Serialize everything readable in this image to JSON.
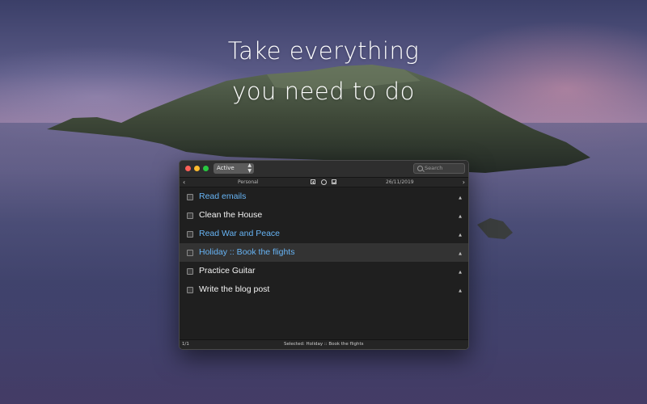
{
  "headline": {
    "line1": "Take everything",
    "line2": "you need to do"
  },
  "window": {
    "filter": {
      "value": "Active",
      "icon": "updown-arrows-icon"
    },
    "search": {
      "placeholder": "Search",
      "icon": "search-icon"
    },
    "nav": {
      "prev_icon": "chevron-left-icon",
      "next_icon": "chevron-right-icon",
      "list_name": "Personal",
      "date": "26/11/2019",
      "tools": [
        "add-icon",
        "circle-icon",
        "checkbox-icon"
      ]
    },
    "tasks": [
      {
        "title": "Read emails",
        "color": "#67b4f5",
        "selected": false
      },
      {
        "title": "Clean the House",
        "color": "#f2f2f2",
        "selected": false
      },
      {
        "title": "Read War and Peace",
        "color": "#67b4f5",
        "selected": false
      },
      {
        "title": "Holiday :: Book the flights",
        "color": "#67b4f5",
        "selected": true
      },
      {
        "title": "Practice Guitar",
        "color": "#f2f2f2",
        "selected": false
      },
      {
        "title": "Write the blog post",
        "color": "#f2f2f2",
        "selected": false
      }
    ],
    "status": {
      "count": "1/1",
      "selected": "Selected: Holiday :: Book the flights"
    }
  },
  "colors": {
    "accent_blue": "#67b4f5",
    "traffic_red": "#fe5f57",
    "traffic_yellow": "#febb2e",
    "traffic_green": "#28c840"
  }
}
